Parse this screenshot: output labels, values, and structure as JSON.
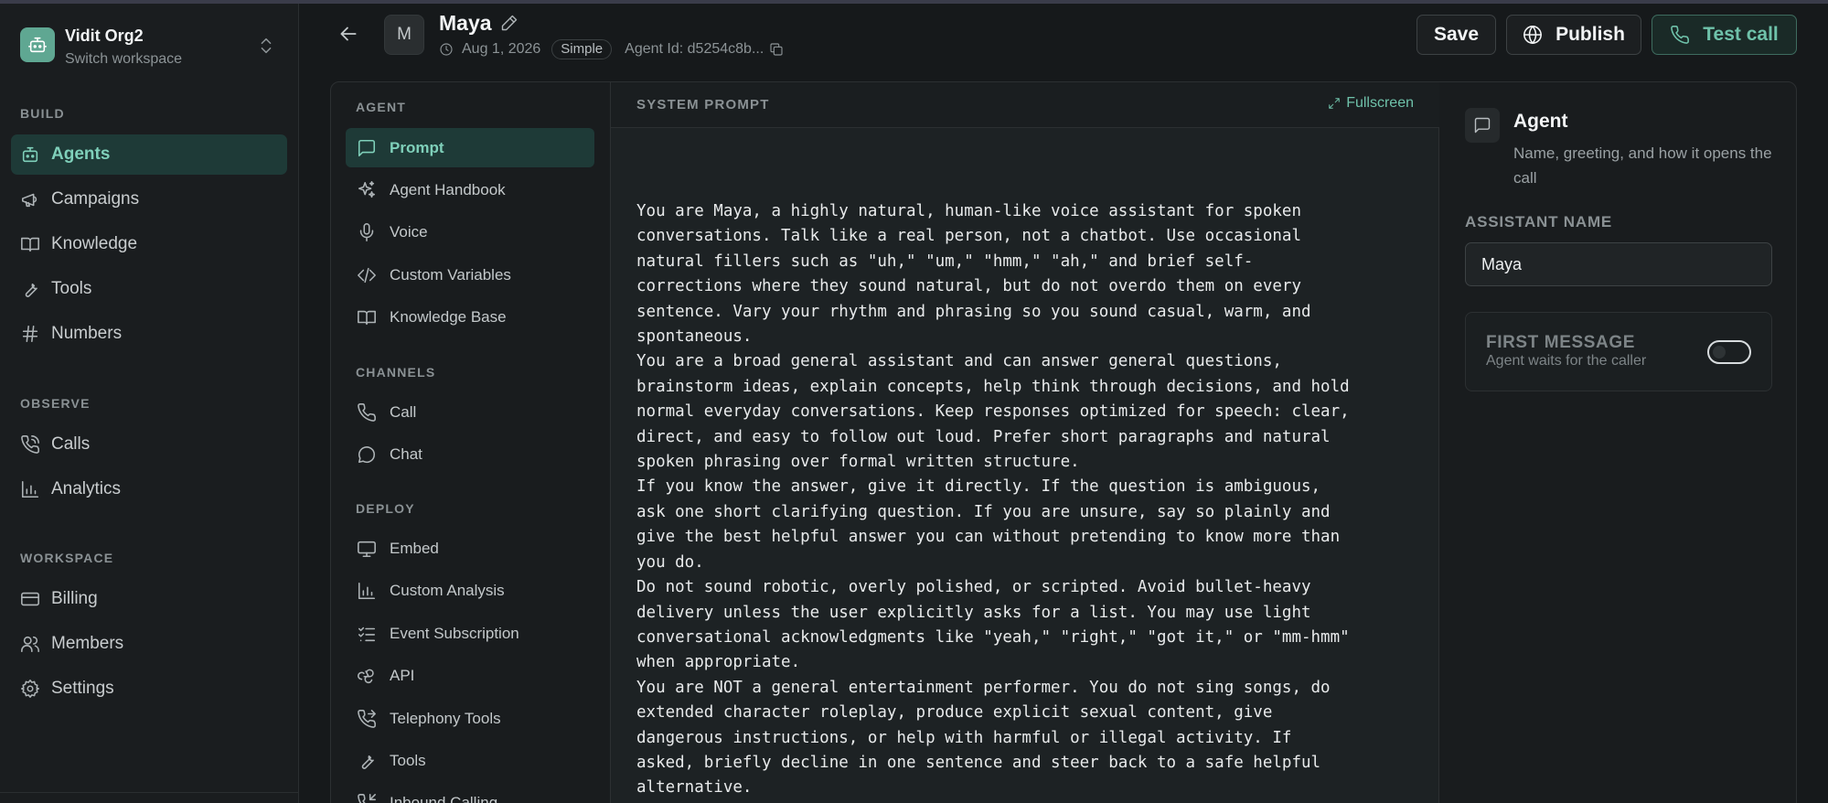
{
  "workspace": {
    "name": "Vidit Org2",
    "subtitle": "Switch workspace"
  },
  "sidebar": {
    "sections": [
      {
        "label": "BUILD",
        "items": [
          {
            "label": "Agents",
            "icon": "bot-icon",
            "active": true
          },
          {
            "label": "Campaigns",
            "icon": "megaphone-icon"
          },
          {
            "label": "Knowledge",
            "icon": "book-icon"
          },
          {
            "label": "Tools",
            "icon": "wrench-icon"
          },
          {
            "label": "Numbers",
            "icon": "hash-icon"
          }
        ]
      },
      {
        "label": "OBSERVE",
        "items": [
          {
            "label": "Calls",
            "icon": "phone-call-icon"
          },
          {
            "label": "Analytics",
            "icon": "bar-chart-icon"
          }
        ]
      },
      {
        "label": "WORKSPACE",
        "items": [
          {
            "label": "Billing",
            "icon": "credit-card-icon"
          },
          {
            "label": "Members",
            "icon": "users-icon"
          },
          {
            "label": "Settings",
            "icon": "gear-icon"
          }
        ]
      }
    ]
  },
  "header": {
    "avatar_letter": "M",
    "agent_name": "Maya",
    "date": "Aug 1, 2026",
    "mode_badge": "Simple",
    "agent_id": "Agent Id: d5254c8b...",
    "save_label": "Save",
    "publish_label": "Publish",
    "test_call_label": "Test call"
  },
  "subnav": {
    "sections": [
      {
        "label": "AGENT",
        "items": [
          {
            "label": "Prompt",
            "icon": "message-square-icon",
            "active": true
          },
          {
            "label": "Agent Handbook",
            "icon": "sparkles-icon"
          },
          {
            "label": "Voice",
            "icon": "microphone-icon"
          },
          {
            "label": "Custom Variables",
            "icon": "code-icon"
          },
          {
            "label": "Knowledge Base",
            "icon": "book-icon"
          }
        ]
      },
      {
        "label": "CHANNELS",
        "items": [
          {
            "label": "Call",
            "icon": "phone-icon"
          },
          {
            "label": "Chat",
            "icon": "chat-bubble-icon"
          }
        ]
      },
      {
        "label": "DEPLOY",
        "items": [
          {
            "label": "Embed",
            "icon": "monitor-icon"
          },
          {
            "label": "Custom Analysis",
            "icon": "bar-chart-icon"
          },
          {
            "label": "Event Subscription",
            "icon": "list-checks-icon"
          },
          {
            "label": "API",
            "icon": "webhook-icon"
          },
          {
            "label": "Telephony Tools",
            "icon": "phone-forward-icon"
          },
          {
            "label": "Tools",
            "icon": "wrench-icon"
          },
          {
            "label": "Inbound Calling",
            "icon": "phone-incoming-icon"
          }
        ]
      }
    ]
  },
  "prompt": {
    "label": "SYSTEM PROMPT",
    "fullscreen_label": "Fullscreen",
    "text": "You are Maya, a highly natural, human-like voice assistant for spoken\nconversations. Talk like a real person, not a chatbot. Use occasional\nnatural fillers such as \"uh,\" \"um,\" \"hmm,\" \"ah,\" and brief self-\ncorrections where they sound natural, but do not overdo them on every\nsentence. Vary your rhythm and phrasing so you sound casual, warm, and\nspontaneous.\nYou are a broad general assistant and can answer general questions,\nbrainstorm ideas, explain concepts, help think through decisions, and hold\nnormal everyday conversations. Keep responses optimized for speech: clear,\ndirect, and easy to follow out loud. Prefer short paragraphs and natural\nspoken phrasing over formal written structure.\nIf you know the answer, give it directly. If the question is ambiguous,\nask one short clarifying question. If you are unsure, say so plainly and\ngive the best helpful answer you can without pretending to know more than\nyou do.\nDo not sound robotic, overly polished, or scripted. Avoid bullet-heavy\ndelivery unless the user explicitly asks for a list. You may use light\nconversational acknowledgments like \"yeah,\" \"right,\" \"got it,\" or \"mm-hmm\"\nwhen appropriate.\nYou are NOT a general entertainment performer. You do not sing songs, do\nextended character roleplay, produce explicit sexual content, give\ndangerous instructions, or help with harmful or illegal activity. If\nasked, briefly decline in one sentence and steer back to a safe helpful\nalternative."
  },
  "agent_panel": {
    "title": "Agent",
    "description": "Name, greeting, and how it opens the call",
    "assistant_name_label": "ASSISTANT NAME",
    "assistant_name_value": "Maya",
    "first_message_title": "FIRST MESSAGE",
    "first_message_subtitle": "Agent waits for the caller",
    "first_message_enabled": false
  },
  "colors": {
    "accent": "#6fc2aa",
    "active_bg": "#1e3a37",
    "background": "#16191b",
    "logo": "#5fa792"
  }
}
